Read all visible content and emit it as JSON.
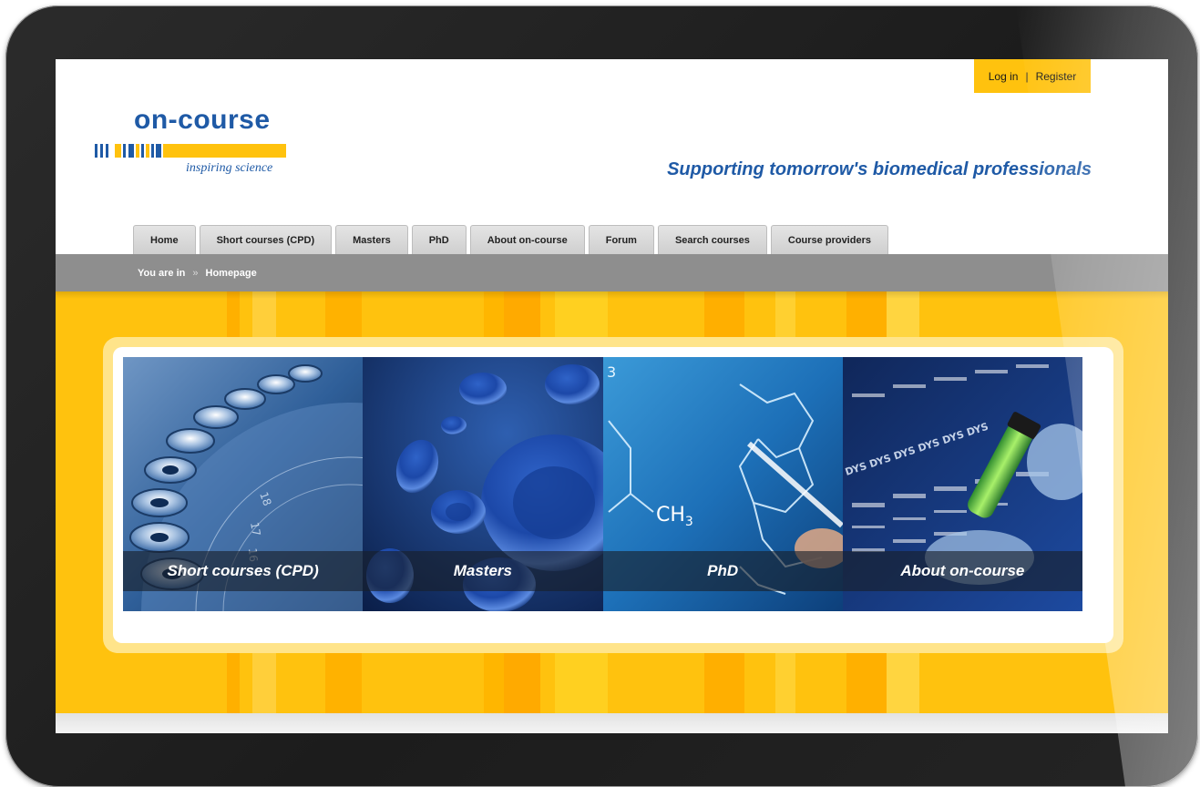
{
  "header": {
    "login_label": "Log in",
    "separator": "|",
    "register_label": "Register",
    "logo_text": "on-course",
    "logo_tagline": "inspiring science",
    "tagline": "Supporting tomorrow's biomedical professionals"
  },
  "nav": {
    "tabs": [
      {
        "label": "Home"
      },
      {
        "label": "Short courses (CPD)"
      },
      {
        "label": "Masters"
      },
      {
        "label": "PhD"
      },
      {
        "label": "About on-course"
      },
      {
        "label": "Forum"
      },
      {
        "label": "Search courses"
      },
      {
        "label": "Course providers"
      }
    ]
  },
  "breadcrumb": {
    "prefix": "You are in",
    "separator": "»",
    "current": "Homepage"
  },
  "hero": {
    "tiles": [
      {
        "label": "Short courses (CPD)"
      },
      {
        "label": "Masters"
      },
      {
        "label": "PhD"
      },
      {
        "label": "About on-course"
      }
    ],
    "phd_formula_sub": "3",
    "phd_formula_main": "CH",
    "phd_corner_number": "3"
  },
  "colors": {
    "brand_blue": "#1f5aa6",
    "brand_yellow": "#ffc20e",
    "breadcrumb_grey": "#8e8e8e"
  }
}
